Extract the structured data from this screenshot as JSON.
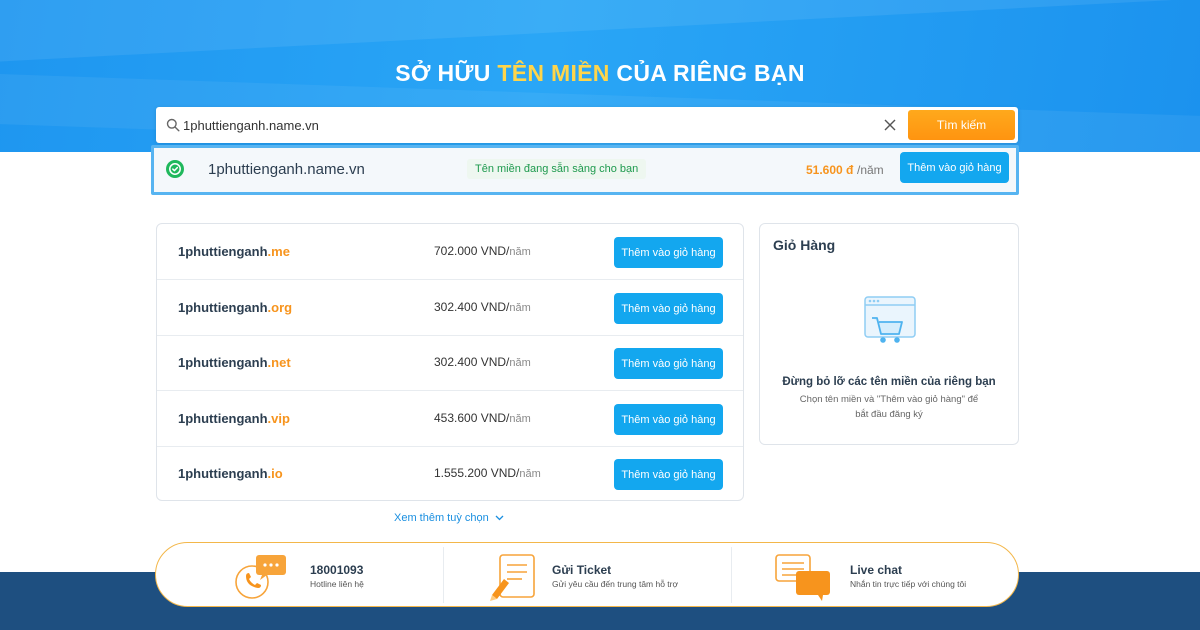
{
  "hero": {
    "title_part1": "SỞ HỮU",
    "title_highlight": "TÊN MIỀN",
    "title_part2": "CỦA RIÊNG BẠN",
    "highlight_color": "#ffd54a",
    "background_color": "#1e96f0"
  },
  "search": {
    "value": "1phuttienganh.name.vn",
    "button_label": "Tìm kiếm",
    "clear_icon": "close-icon",
    "search_icon": "search-icon"
  },
  "result": {
    "domain": "1phuttienganh.name.vn",
    "status": "Tên miền đang sẵn sàng cho bạn",
    "price": "51.600 đ",
    "unit": "/năm",
    "add_label": "Thêm vào giỏ hàng",
    "status_icon": "check-circle-icon"
  },
  "suggestions": [
    {
      "name": "1phuttienganh",
      "tld": ".me",
      "price": "702.000 VND/",
      "unit": "năm",
      "add_label": "Thêm vào giỏ hàng"
    },
    {
      "name": "1phuttienganh",
      "tld": ".org",
      "price": "302.400 VND/",
      "unit": "năm",
      "add_label": "Thêm vào giỏ hàng"
    },
    {
      "name": "1phuttienganh",
      "tld": ".net",
      "price": "302.400 VND/",
      "unit": "năm",
      "add_label": "Thêm vào giỏ hàng"
    },
    {
      "name": "1phuttienganh",
      "tld": ".vip",
      "price": "453.600 VND/",
      "unit": "năm",
      "add_label": "Thêm vào giỏ hàng"
    },
    {
      "name": "1phuttienganh",
      "tld": ".io",
      "price": "1.555.200 VND/",
      "unit": "năm",
      "add_label": "Thêm vào giỏ hàng"
    }
  ],
  "more_options": "Xem thêm tuỳ chọn",
  "cart": {
    "title": "Giỏ Hàng",
    "empty_title": "Đừng bỏ lỡ các tên miền của riêng bạn",
    "empty_subtitle": "Chọn tên miền và \"Thêm vào giỏ hàng\" để bắt đầu đăng ký",
    "icon": "cart-icon"
  },
  "support": [
    {
      "title": "18001093",
      "subtitle": "Hotline liên hệ",
      "icon": "phone-icon"
    },
    {
      "title": "Gửi Ticket",
      "subtitle": "Gửi yêu cầu đến trung tâm hỗ trợ",
      "icon": "ticket-icon"
    },
    {
      "title": "Live chat",
      "subtitle": "Nhắn tin trực tiếp với chúng tôi",
      "icon": "chat-icon"
    }
  ],
  "colors": {
    "accent_blue": "#13a7ef",
    "accent_orange": "#f7941d",
    "footer_band": "#1e4f80"
  }
}
